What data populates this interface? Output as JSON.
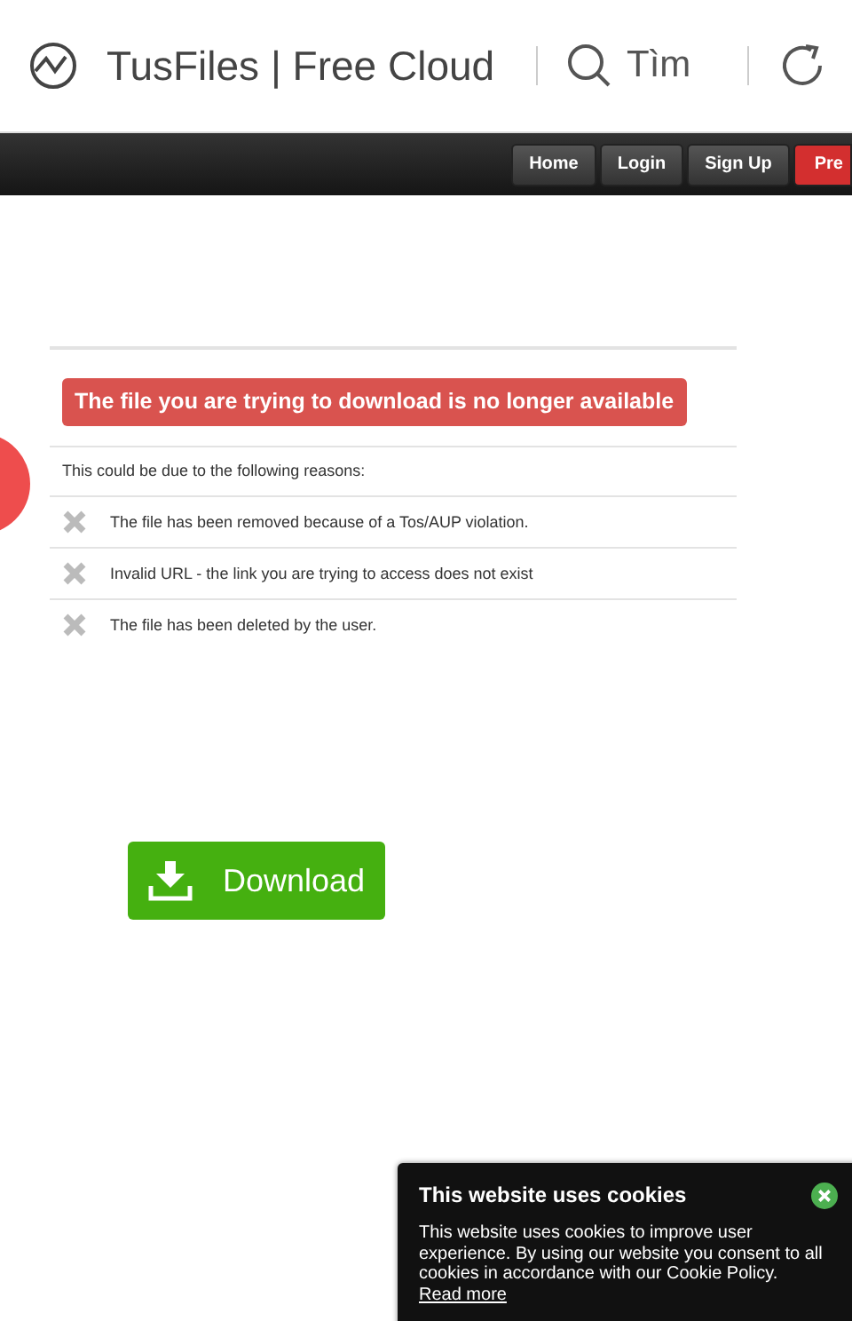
{
  "browser": {
    "title": "TusFiles | Free Cloud",
    "search_label": "Tìm"
  },
  "nav": {
    "buttons": [
      {
        "label": "Home",
        "kind": "plain"
      },
      {
        "label": "Login",
        "kind": "plain"
      },
      {
        "label": "Sign Up",
        "kind": "plain"
      },
      {
        "label": "Pre",
        "kind": "premium"
      }
    ]
  },
  "error": {
    "title": "The file you are trying to download is no longer available",
    "intro": "This could be due to the following reasons:",
    "reasons": [
      "The file has been removed because of a Tos/AUP violation.",
      "Invalid URL - the link you are trying to access does not exist",
      "The file has been deleted by the user."
    ]
  },
  "download_button": {
    "label": "Download"
  },
  "cookie_notice": {
    "title": "This website uses cookies",
    "text": "This website uses cookies to improve user experience. By using our website you consent to all cookies in accordance with our Cookie Policy.",
    "link": "Read more"
  }
}
